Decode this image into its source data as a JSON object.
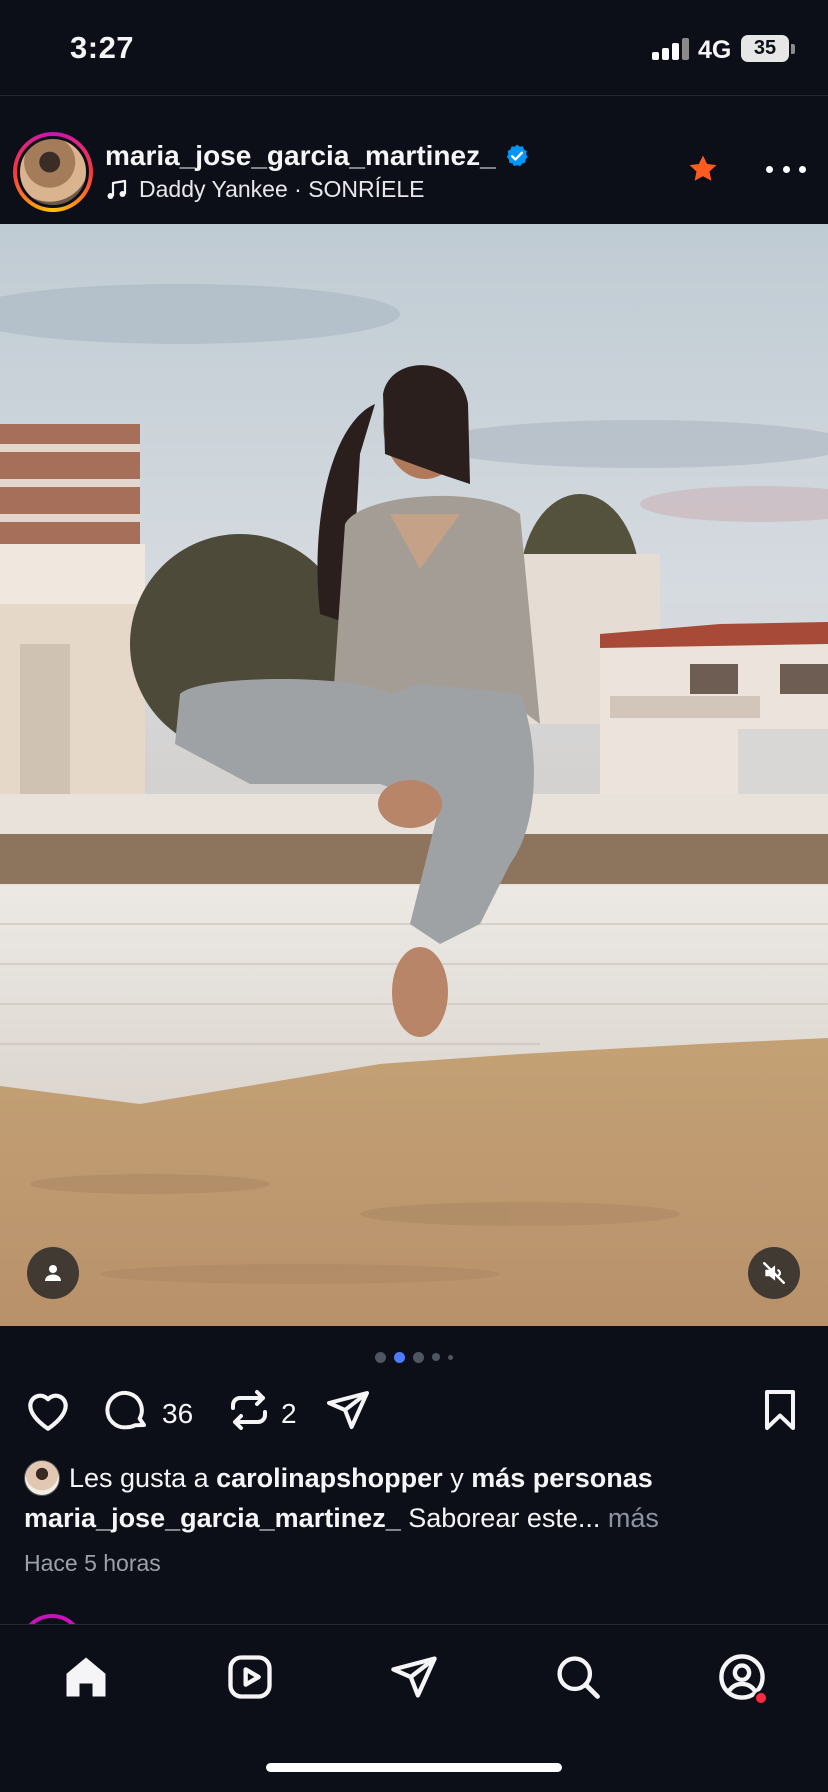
{
  "status_bar": {
    "time": "3:27",
    "network": "4G",
    "battery": "35"
  },
  "post": {
    "username": "maria_jose_garcia_martinez_",
    "verified": true,
    "song": "Daddy Yankee · SONRÍELE",
    "icons": [
      "verified-badge-icon",
      "music-note-icon",
      "star-icon",
      "more-icon",
      "person-icon",
      "muted-speaker-icon"
    ],
    "colors": {
      "verified": "#0095f6",
      "star": "#ff5a1f",
      "active_dot": "#4f7cff"
    },
    "carousel": {
      "count": 5,
      "active_index": 1
    },
    "comments_count": "36",
    "reposts_count": "2",
    "likes": {
      "prefix": "Les gusta a",
      "user": "carolinapshopper",
      "connector": "y",
      "others": "más personas"
    },
    "caption": {
      "username": "maria_jose_garcia_martinez_",
      "text": "Saborear este...",
      "more": "más"
    },
    "timestamp": "Hace 5 horas"
  },
  "actions": {
    "icons": [
      "heart-icon",
      "comment-icon",
      "repost-icon",
      "share-icon",
      "bookmark-icon"
    ]
  },
  "tab_bar": {
    "icons": [
      "home-icon",
      "reels-icon",
      "messages-icon",
      "search-icon",
      "profile-icon"
    ],
    "notification_color": "#ff2b45"
  }
}
